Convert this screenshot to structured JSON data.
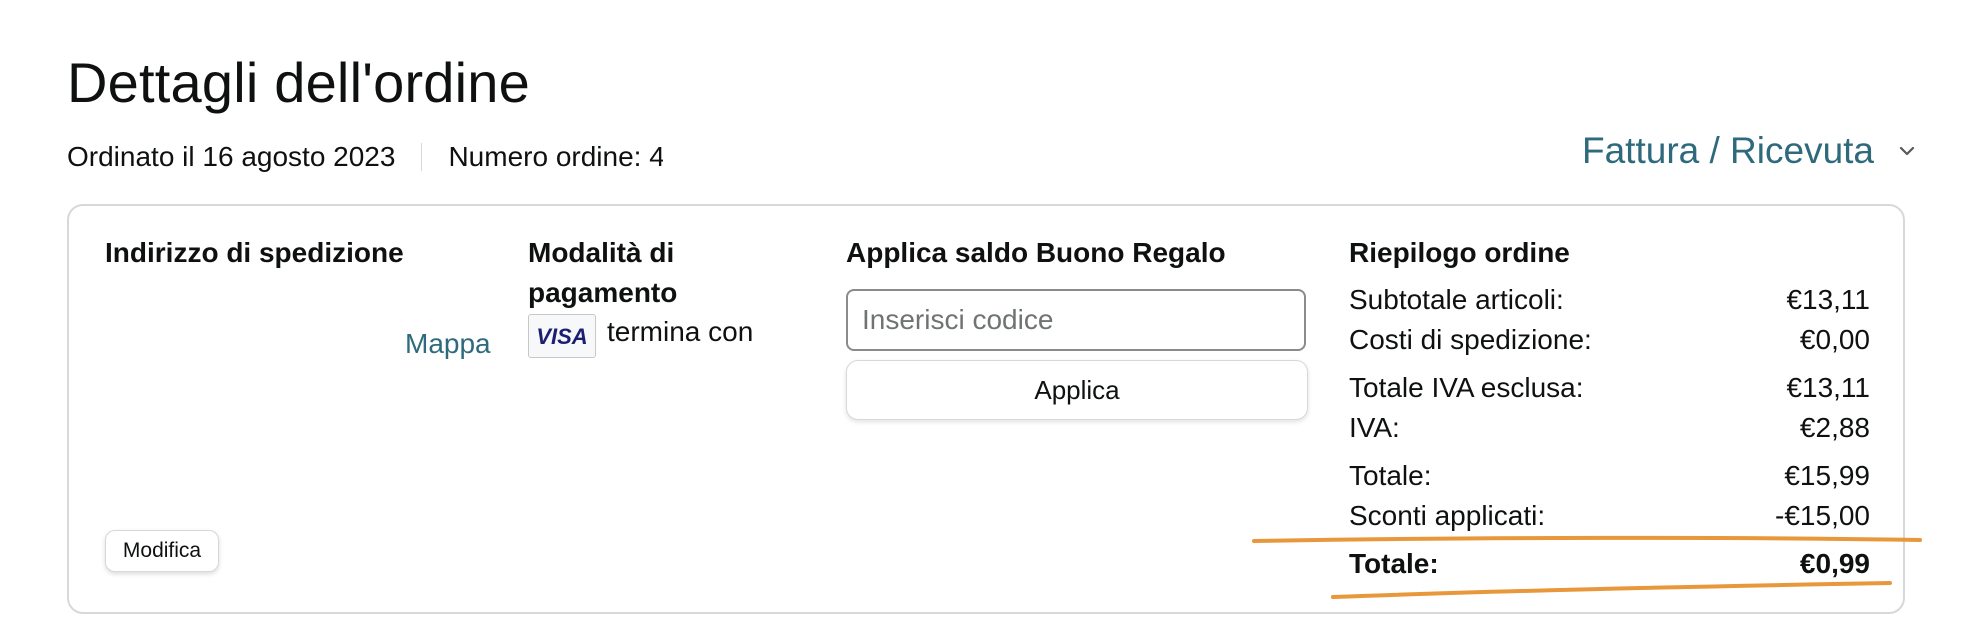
{
  "page": {
    "title": "Dettagli dell'ordine",
    "ordered_on": "Ordinato il 16 agosto 2023",
    "order_number_label": "Numero ordine: 4",
    "invoice_link": "Fattura / Ricevuta"
  },
  "shipping": {
    "heading": "Indirizzo di spedizione",
    "map_link": "Mappa",
    "edit_button": "Modifica"
  },
  "payment": {
    "heading": "Modalità di pagamento",
    "card_brand": "VISA",
    "card_text": "termina con"
  },
  "gift_card": {
    "heading": "Applica saldo Buono Regalo",
    "placeholder": "Inserisci codice",
    "value": "",
    "apply_button": "Applica"
  },
  "summary": {
    "heading": "Riepilogo ordine",
    "rows": [
      {
        "label": "Subtotale articoli:",
        "value": "€13,11"
      },
      {
        "label": "Costi di spedizione:",
        "value": "€0,00"
      },
      {
        "label": "Totale IVA esclusa:",
        "value": "€13,11"
      },
      {
        "label": "IVA:",
        "value": "€2,88"
      },
      {
        "label": "Totale:",
        "value": "€15,99"
      },
      {
        "label": "Sconti applicati:",
        "value": "-€15,00"
      }
    ],
    "grand_total": {
      "label": "Totale:",
      "value": "€0,99"
    }
  },
  "colors": {
    "link": "#2e6a7c",
    "annotation": "#e8983a",
    "border": "#d5d9d9"
  },
  "icons": {
    "invoice_dropdown": "chevron-down-icon",
    "card": "visa-card-icon"
  }
}
